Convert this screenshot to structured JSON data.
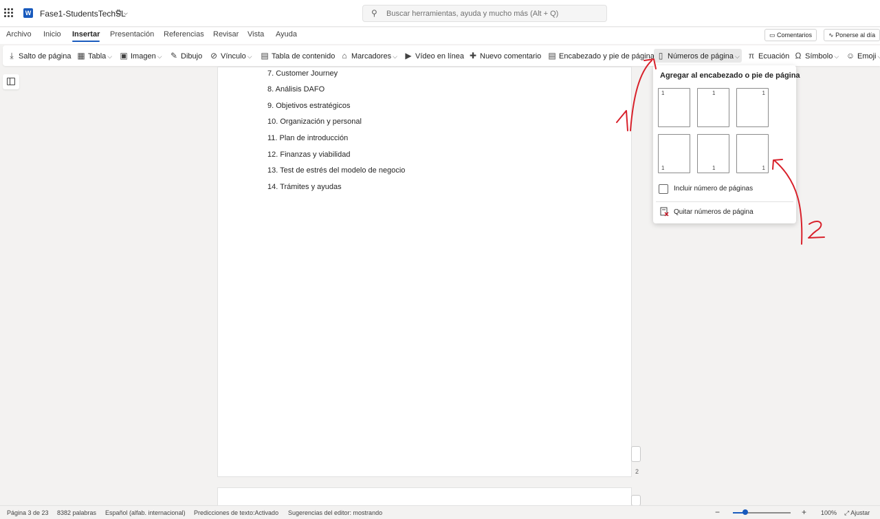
{
  "titlebar": {
    "doc_title": "Fase1-StudentsTechSL",
    "search_placeholder": "Buscar herramientas, ayuda y mucho más (Alt + Q)"
  },
  "tabs": [
    {
      "label": "Archivo"
    },
    {
      "label": "Inicio"
    },
    {
      "label": "Insertar",
      "active": true
    },
    {
      "label": "Presentación"
    },
    {
      "label": "Referencias"
    },
    {
      "label": "Revisar"
    },
    {
      "label": "Vista"
    },
    {
      "label": "Ayuda"
    }
  ],
  "right_pills": {
    "comments": "Comentarios",
    "catch_up": "Ponerse al día"
  },
  "ribbon": {
    "page_break": "Salto de página",
    "table": "Tabla",
    "image": "Imagen",
    "drawing": "Dibujo",
    "link": "Vínculo",
    "toc": "Tabla de contenido",
    "bookmarks": "Marcadores",
    "online_video": "Vídeo en línea",
    "new_comment": "Nuevo comentario",
    "header_footer": "Encabezado y pie de página",
    "page_numbers": "Números de página",
    "equation": "Ecuación",
    "symbol": "Símbolo",
    "emoji": "Emoji"
  },
  "document": {
    "toc_lines": [
      "7. Customer Journey",
      "8. Análisis DAFO",
      "9. Objetivos estratégicos",
      "10. Organización y personal",
      "11. Plan de introducción",
      "12. Finanzas y viabilidad",
      "13. Test de estrés del modelo de negocio",
      "14. Trámites y ayudas"
    ],
    "page_number": "2"
  },
  "dropdown": {
    "heading": "Agregar al encabezado o pie de página",
    "thumb_number": "1",
    "include_count_label": "Incluir número de páginas",
    "remove_label": "Quitar números de página"
  },
  "statusbar": {
    "page": "Página 3 de 23",
    "words": "8382 palabras",
    "language": "Español (alfab. internacional)",
    "predictions": "Predicciones de texto:Activado",
    "suggestions": "Sugerencias del editor: mostrando",
    "zoom": "100%",
    "fit": "Ajustar",
    "zoom_level": 0.22
  },
  "annotations": {
    "label_1": "1",
    "label_2": "2",
    "color": "#d8202a"
  },
  "colors": {
    "accent": "#185abd"
  }
}
